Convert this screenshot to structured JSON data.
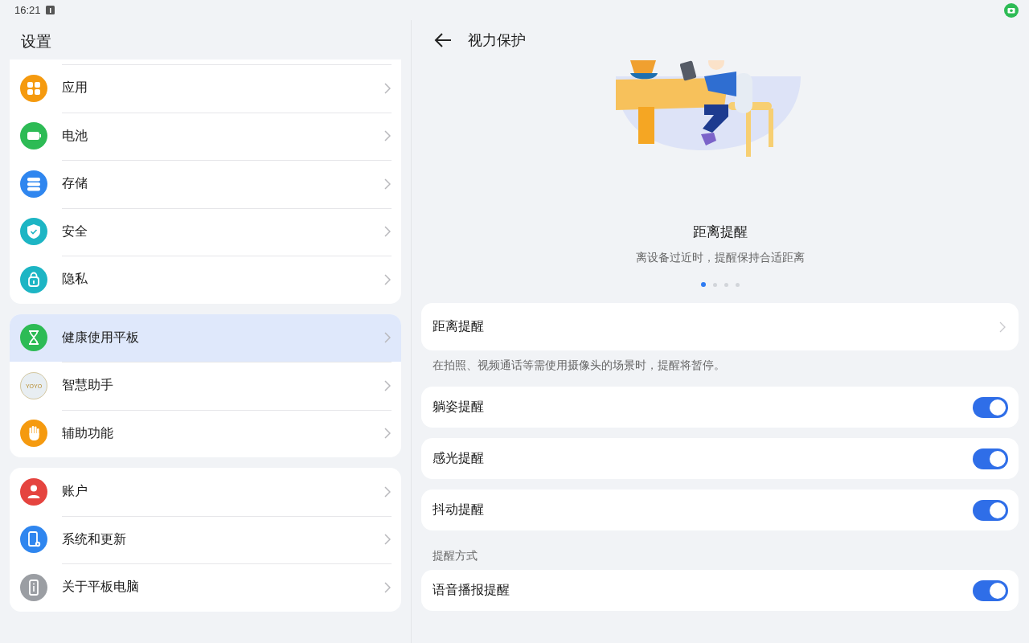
{
  "status_bar": {
    "time": "16:21"
  },
  "sidebar": {
    "title": "设置",
    "groups": [
      {
        "items": [
          {
            "label": "应用",
            "kind": "apps",
            "color": "#f59a0f",
            "selected": false
          },
          {
            "label": "电池",
            "kind": "battery",
            "color": "#2dbb55",
            "selected": false
          },
          {
            "label": "存储",
            "kind": "storage",
            "color": "#2f86ef",
            "selected": false
          },
          {
            "label": "安全",
            "kind": "shield",
            "color": "#1db5c4",
            "selected": false
          },
          {
            "label": "隐私",
            "kind": "lock",
            "color": "#1db5c4",
            "selected": false
          }
        ]
      },
      {
        "items": [
          {
            "label": "健康使用平板",
            "kind": "hourglass",
            "color": "#2dbb55",
            "selected": true
          },
          {
            "label": "智慧助手",
            "kind": "logo",
            "logo_text": "YOYO",
            "color": "#e8eef2",
            "selected": false
          },
          {
            "label": "辅助功能",
            "kind": "hand",
            "color": "#f59a0f",
            "selected": false
          }
        ]
      },
      {
        "items": [
          {
            "label": "账户",
            "kind": "person",
            "color": "#e5443f",
            "selected": false
          },
          {
            "label": "系统和更新",
            "kind": "phone-gear",
            "color": "#2f86ef",
            "selected": false
          },
          {
            "label": "关于平板电脑",
            "kind": "info",
            "color": "#9b9ea3",
            "selected": false
          }
        ]
      }
    ]
  },
  "detail": {
    "title": "视力保护",
    "carousel": {
      "title": "距离提醒",
      "subtitle": "离设备过近时，提醒保持合适距离",
      "dots": [
        {
          "selected": true
        },
        {
          "selected": false
        },
        {
          "selected": false
        },
        {
          "selected": false
        }
      ]
    },
    "link_row": {
      "label": "距离提醒"
    },
    "note": "在拍照、视频通话等需使用摄像头的场景时，提醒将暂停。",
    "toggles": [
      {
        "label": "躺姿提醒",
        "on": true
      },
      {
        "label": "感光提醒",
        "on": true
      },
      {
        "label": "抖动提醒",
        "on": true
      }
    ],
    "section_label": "提醒方式",
    "section_toggles": [
      {
        "label": "语音播报提醒",
        "on": true
      }
    ]
  }
}
